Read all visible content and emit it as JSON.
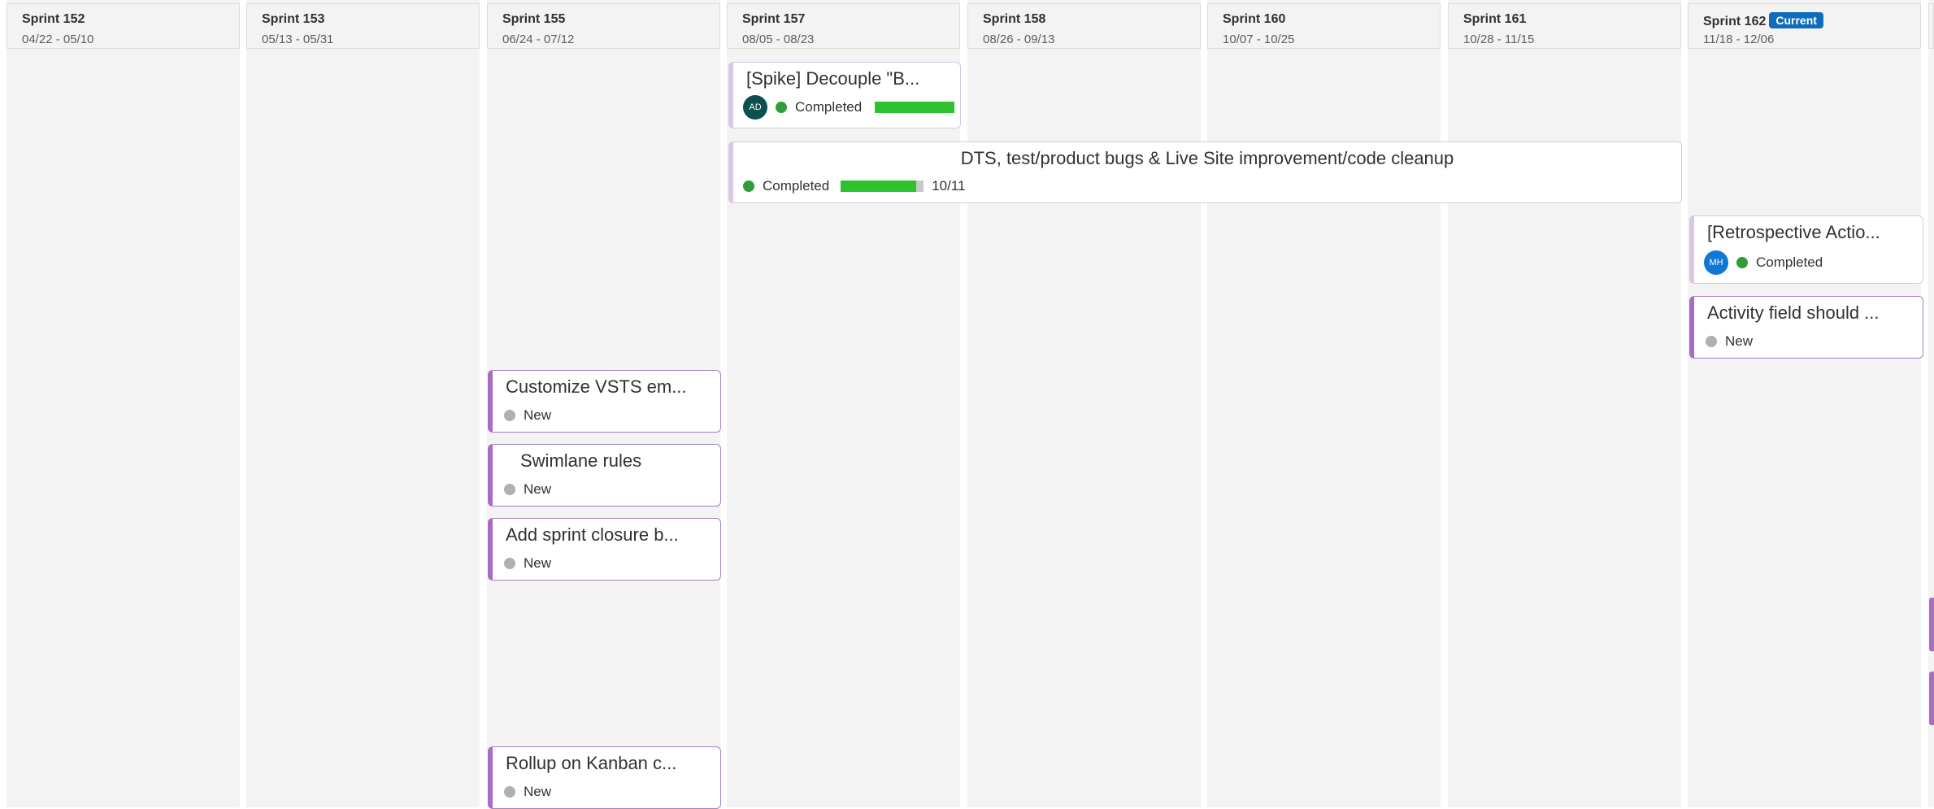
{
  "sprints": [
    {
      "title": "Sprint 152",
      "dates": "04/22 - 05/10"
    },
    {
      "title": "Sprint 153",
      "dates": "05/13 - 05/31"
    },
    {
      "title": "Sprint 155",
      "dates": "06/24 - 07/12"
    },
    {
      "title": "Sprint 157",
      "dates": "08/05 - 08/23"
    },
    {
      "title": "Sprint 158",
      "dates": "08/26 - 09/13"
    },
    {
      "title": "Sprint 160",
      "dates": "10/07 - 10/25"
    },
    {
      "title": "Sprint 161",
      "dates": "10/28 - 11/15"
    },
    {
      "title": "Sprint 162",
      "dates": "11/18 - 12/06",
      "badge": "Current"
    }
  ],
  "cards": {
    "spike": {
      "title": "[Spike] Decouple \"B...",
      "status": "Completed",
      "avatar": "AD",
      "progress": 1.0
    },
    "dts": {
      "title": "DTS, test/product bugs & Live Site improvement/code cleanup",
      "status": "Completed",
      "progress": 0.91,
      "progress_text": "10/11"
    },
    "retro": {
      "title": "[Retrospective Actio...",
      "status": "Completed",
      "avatar": "MH"
    },
    "activity": {
      "title": "Activity field should ...",
      "status": "New"
    },
    "customize": {
      "title": "Customize VSTS em...",
      "status": "New"
    },
    "swimlane": {
      "title": "Swimlane rules",
      "status": "New"
    },
    "add_sprint": {
      "title": "Add sprint closure b...",
      "status": "New"
    },
    "rollup": {
      "title": "Rollup on Kanban c...",
      "status": "New"
    }
  },
  "colors": {
    "accent": "#a76cc4",
    "completed": "#2e9e3a",
    "new": "#b0b0b0",
    "progress": "#2fc22f",
    "current_badge": "#0f6cbd",
    "avatar_ad": "#0b4f4f",
    "avatar_mh": "#0f78d4"
  }
}
